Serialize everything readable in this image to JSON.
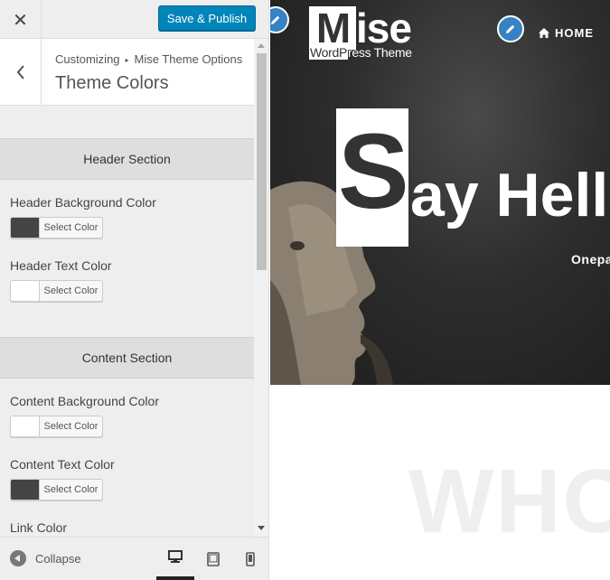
{
  "customizer": {
    "close_label": "✕",
    "publish_label": "Save & Publish",
    "breadcrumb": {
      "parent": "Customizing",
      "separator": "▸",
      "current": "Mise Theme Options"
    },
    "section_title": "Theme Colors",
    "groups": [
      {
        "title": "Header Section",
        "fields": [
          {
            "label": "Header Background Color",
            "button_label": "Select Color",
            "color": "#444444"
          },
          {
            "label": "Header Text Color",
            "button_label": "Select Color",
            "color": "#ffffff"
          }
        ]
      },
      {
        "title": "Content Section",
        "fields": [
          {
            "label": "Content Background Color",
            "button_label": "Select Color",
            "color": "#ffffff"
          },
          {
            "label": "Content Text Color",
            "button_label": "Select Color",
            "color": "#444444"
          },
          {
            "label": "Link Color"
          }
        ]
      }
    ],
    "footer": {
      "collapse_label": "Collapse",
      "devices": [
        "desktop",
        "tablet",
        "mobile"
      ],
      "active_device": "desktop"
    }
  },
  "preview": {
    "logo": {
      "first_letter": "M",
      "rest": "ise",
      "sub_highlight": "WordP",
      "sub_rest": "ress Theme"
    },
    "nav": {
      "home_label": "HOME"
    },
    "hero": {
      "highlight_letter": "S",
      "title_rest": "ay Hell",
      "subtitle": "Onepa"
    },
    "section_heading": "WHO"
  },
  "colors": {
    "accent": "#0085ba",
    "edit_bubble": "#3582c4",
    "hero_background": "#2d2d2d"
  }
}
